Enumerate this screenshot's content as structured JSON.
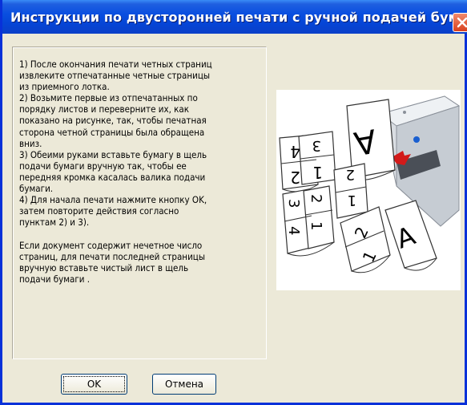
{
  "window": {
    "title": "Инструкции по двусторонней печати с ручной подачей бумаги"
  },
  "instructions": {
    "text": "1) После окончания печати четных страниц\nизвлеките отпечатанные четные страницы\nиз приемного лотка.\n2) Возьмите первые из отпечатанных по\nпорядку листов и переверните их, как\nпоказано на рисунке, так, чтобы печатная\nсторона четной страницы была обращена\nвниз.\n3) Обеими руками вставьте бумагу в щель\nподачи бумаги вручную так, чтобы ее\nпередняя кромка касалась валика подачи\nбумаги.\n4) Для начала печати нажмите кнопку OK,\nзатем повторите действия согласно\nпунктам 2) и 3).\n\n Если документ содержит нечетное число\nстраниц, для печати последней страницы\nвручную вставьте чистый лист в щель\nподачи бумаги ."
  },
  "buttons": {
    "ok": "OK",
    "cancel": "Отмена"
  },
  "illustration": {
    "page_labels": [
      "4",
      "3",
      "2",
      "1",
      "A",
      "3",
      "4",
      "2",
      "1",
      "2",
      "1",
      "A"
    ]
  }
}
